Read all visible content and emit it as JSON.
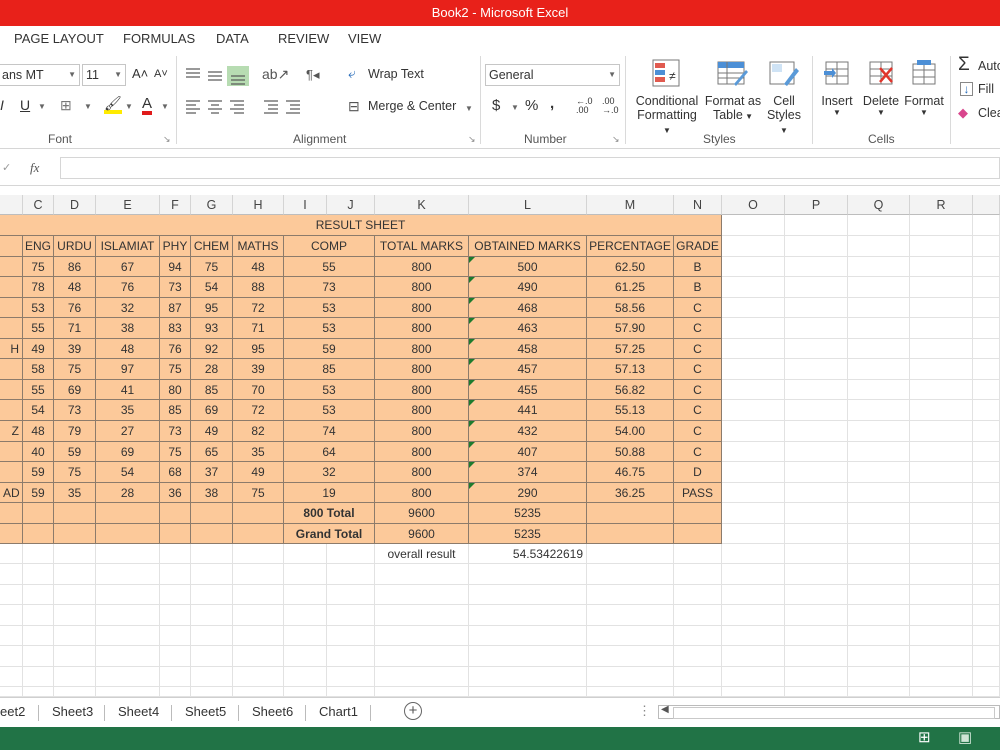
{
  "window": {
    "title": "Book2 -  Microsoft Excel"
  },
  "ribbon_tabs": [
    "PAGE LAYOUT",
    "FORMULAS",
    "DATA",
    "REVIEW",
    "VIEW"
  ],
  "font": {
    "name": "ans MT",
    "size": "11",
    "group_label": "Font"
  },
  "alignment": {
    "wrap_text": "Wrap Text",
    "merge_center": "Merge & Center",
    "group_label": "Alignment"
  },
  "number": {
    "format": "General",
    "currency": "$",
    "percent": "%",
    "comma": ",",
    "group_label": "Number"
  },
  "styles": {
    "conditional_1": "Conditional",
    "conditional_2": "Formatting",
    "format_table_1": "Format as",
    "format_table_2": "Table",
    "cell_styles_1": "Cell",
    "cell_styles_2": "Styles",
    "group_label": "Styles"
  },
  "cells_group": {
    "insert": "Insert",
    "delete": "Delete",
    "format": "Format",
    "group_label": "Cells"
  },
  "editing": {
    "autosum": "Auto",
    "fill": "Fill",
    "clear": "Clea"
  },
  "formula_bar": {
    "fx": "fx",
    "value": ""
  },
  "columns": [
    "C",
    "D",
    "E",
    "F",
    "G",
    "H",
    "I",
    "J",
    "K",
    "L",
    "M",
    "N",
    "O",
    "P",
    "Q",
    "R"
  ],
  "sheet": {
    "title": "RESULT SHEET",
    "headers": [
      "ENG",
      "URDU",
      "ISLAMIAT",
      "PHY",
      "CHEM",
      "MATHS",
      "COMP",
      "TOTAL MARKS",
      "OBTAINED MARKS",
      "PERCENTAGE",
      "GRADE"
    ],
    "rows": [
      {
        "name": "",
        "eng": "75",
        "urdu": "86",
        "isl": "67",
        "phy": "94",
        "chem": "75",
        "maths": "48",
        "comp": "55",
        "total": "800",
        "obtained": "500",
        "pct": "62.50",
        "grade": "B"
      },
      {
        "name": "",
        "eng": "78",
        "urdu": "48",
        "isl": "76",
        "phy": "73",
        "chem": "54",
        "maths": "88",
        "comp": "73",
        "total": "800",
        "obtained": "490",
        "pct": "61.25",
        "grade": "B"
      },
      {
        "name": "",
        "eng": "53",
        "urdu": "76",
        "isl": "32",
        "phy": "87",
        "chem": "95",
        "maths": "72",
        "comp": "53",
        "total": "800",
        "obtained": "468",
        "pct": "58.56",
        "grade": "C"
      },
      {
        "name": "",
        "eng": "55",
        "urdu": "71",
        "isl": "38",
        "phy": "83",
        "chem": "93",
        "maths": "71",
        "comp": "53",
        "total": "800",
        "obtained": "463",
        "pct": "57.90",
        "grade": "C"
      },
      {
        "name": "H",
        "eng": "49",
        "urdu": "39",
        "isl": "48",
        "phy": "76",
        "chem": "92",
        "maths": "95",
        "comp": "59",
        "total": "800",
        "obtained": "458",
        "pct": "57.25",
        "grade": "C"
      },
      {
        "name": "",
        "eng": "58",
        "urdu": "75",
        "isl": "97",
        "phy": "75",
        "chem": "28",
        "maths": "39",
        "comp": "85",
        "total": "800",
        "obtained": "457",
        "pct": "57.13",
        "grade": "C"
      },
      {
        "name": "",
        "eng": "55",
        "urdu": "69",
        "isl": "41",
        "phy": "80",
        "chem": "85",
        "maths": "70",
        "comp": "53",
        "total": "800",
        "obtained": "455",
        "pct": "56.82",
        "grade": "C"
      },
      {
        "name": "",
        "eng": "54",
        "urdu": "73",
        "isl": "35",
        "phy": "85",
        "chem": "69",
        "maths": "72",
        "comp": "53",
        "total": "800",
        "obtained": "441",
        "pct": "55.13",
        "grade": "C"
      },
      {
        "name": "Z",
        "eng": "48",
        "urdu": "79",
        "isl": "27",
        "phy": "73",
        "chem": "49",
        "maths": "82",
        "comp": "74",
        "total": "800",
        "obtained": "432",
        "pct": "54.00",
        "grade": "C"
      },
      {
        "name": "",
        "eng": "40",
        "urdu": "59",
        "isl": "69",
        "phy": "75",
        "chem": "65",
        "maths": "35",
        "comp": "64",
        "total": "800",
        "obtained": "407",
        "pct": "50.88",
        "grade": "C"
      },
      {
        "name": "",
        "eng": "59",
        "urdu": "75",
        "isl": "54",
        "phy": "68",
        "chem": "37",
        "maths": "49",
        "comp": "32",
        "total": "800",
        "obtained": "374",
        "pct": "46.75",
        "grade": "D"
      },
      {
        "name": "AD",
        "eng": "59",
        "urdu": "35",
        "isl": "28",
        "phy": "36",
        "chem": "38",
        "maths": "75",
        "comp": "19",
        "total": "800",
        "obtained": "290",
        "pct": "36.25",
        "grade": "PASS"
      }
    ],
    "total_row": {
      "label": "800 Total",
      "total": "9600",
      "obtained": "5235"
    },
    "grand_row": {
      "label": "Grand Total",
      "total": "9600",
      "obtained": "5235"
    },
    "overall": {
      "label": "overall result",
      "value": "54.53422619"
    }
  },
  "sheet_tabs": [
    "eet2",
    "Sheet3",
    "Sheet4",
    "Sheet5",
    "Sheet6",
    "Chart1"
  ],
  "colors": {
    "title_bar": "#e8211a",
    "table_fill": "#fcc99a",
    "status_bar": "#217346",
    "header_bg": "#f3f3f3"
  }
}
